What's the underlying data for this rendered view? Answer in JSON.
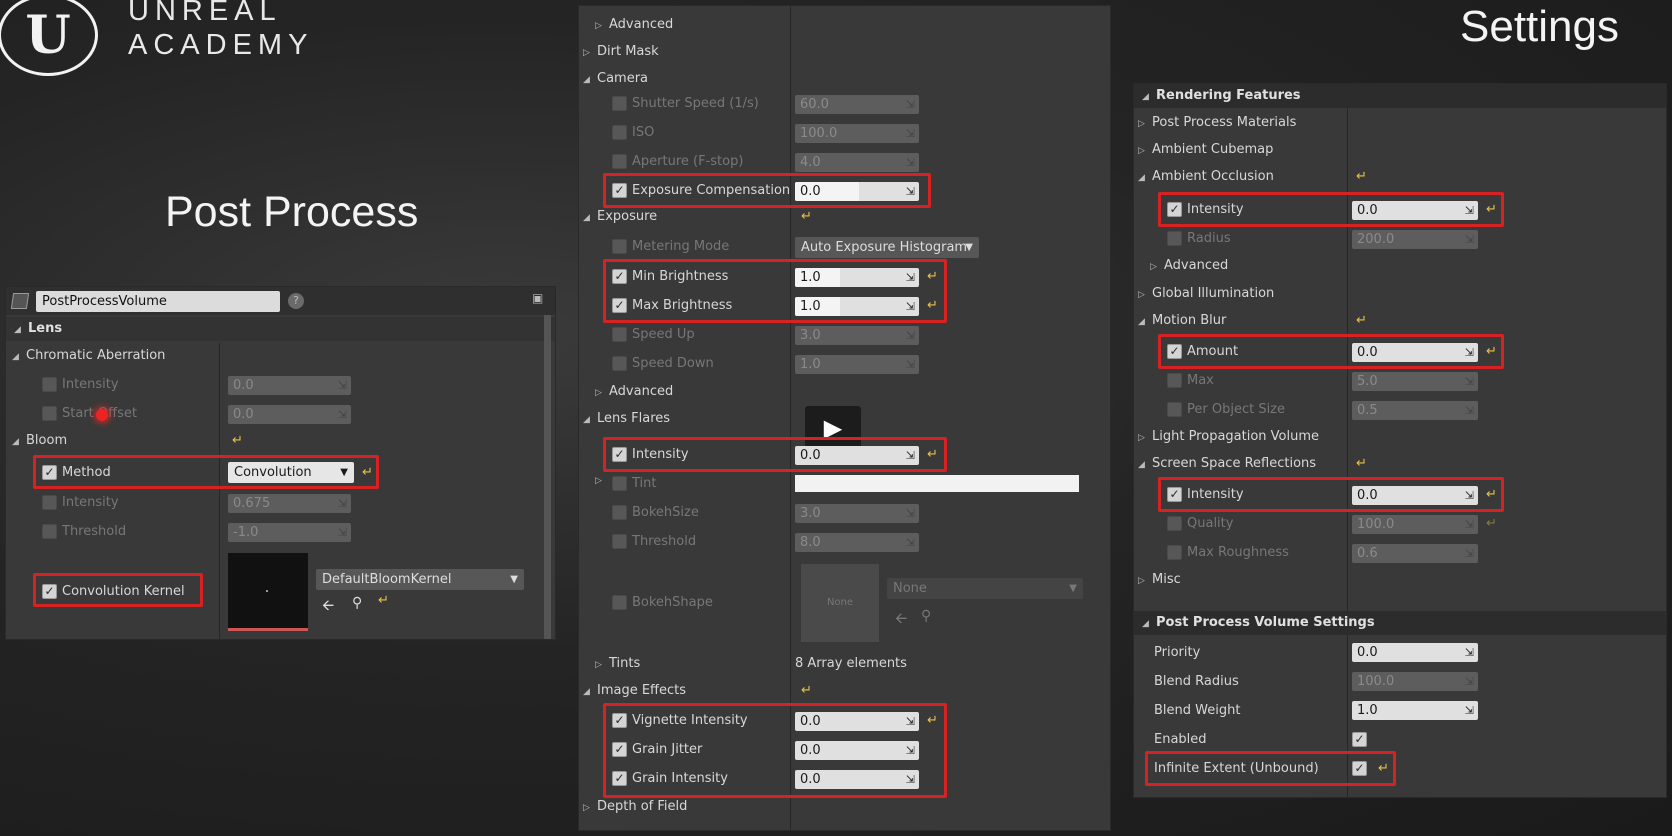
{
  "brand": {
    "line1": "UNREAL",
    "line2": "ACADEMY",
    "logo_letter": "U"
  },
  "slide": {
    "title_left": "Post Process",
    "title_right": "Settings"
  },
  "left": {
    "actor_name": "PostProcessVolume",
    "help_icon": "?",
    "header": "Lens",
    "chromatic": {
      "label": "Chromatic Aberration",
      "intensity_label": "Intensity",
      "intensity_value": "0.0",
      "start_offset_label": "Start Offset",
      "start_offset_value": "0.0"
    },
    "bloom": {
      "label": "Bloom",
      "method_label": "Method",
      "method_value": "Convolution",
      "intensity_label": "Intensity",
      "intensity_value": "0.675",
      "threshold_label": "Threshold",
      "threshold_value": "-1.0",
      "kernel_label": "Convolution Kernel",
      "kernel_asset": "DefaultBloomKernel"
    }
  },
  "middle": {
    "advanced_top": "Advanced",
    "dirt_mask": "Dirt Mask",
    "camera": {
      "label": "Camera",
      "shutter_label": "Shutter Speed (1/s)",
      "shutter_value": "60.0",
      "iso_label": "ISO",
      "iso_value": "100.0",
      "aperture_label": "Aperture (F-stop)",
      "aperture_value": "4.0",
      "exposure_comp_label": "Exposure Compensation",
      "exposure_comp_value": "0.0"
    },
    "exposure": {
      "label": "Exposure",
      "metering_label": "Metering Mode",
      "metering_value": "Auto Exposure Histogram",
      "min_label": "Min Brightness",
      "min_value": "1.0",
      "max_label": "Max Brightness",
      "max_value": "1.0",
      "speed_up_label": "Speed Up",
      "speed_up_value": "3.0",
      "speed_down_label": "Speed Down",
      "speed_down_value": "1.0",
      "advanced": "Advanced"
    },
    "lens_flares": {
      "label": "Lens Flares",
      "intensity_label": "Intensity",
      "intensity_value": "0.0",
      "tint_label": "Tint",
      "bokeh_size_label": "BokehSize",
      "bokeh_size_value": "3.0",
      "threshold_label": "Threshold",
      "threshold_value": "8.0",
      "bokeh_shape_label": "BokehShape",
      "bokeh_shape_thumb": "None",
      "bokeh_shape_value": "None"
    },
    "tints": {
      "label": "Tints",
      "value": "8 Array elements"
    },
    "image_effects": {
      "label": "Image Effects",
      "vignette_label": "Vignette Intensity",
      "vignette_value": "0.0",
      "grain_jitter_label": "Grain Jitter",
      "grain_jitter_value": "0.0",
      "grain_intensity_label": "Grain Intensity",
      "grain_intensity_value": "0.0"
    },
    "depth_of_field": "Depth of Field"
  },
  "right": {
    "header": "Rendering Features",
    "ppm": "Post Process Materials",
    "ambient_cubemap": "Ambient Cubemap",
    "ambient_occlusion": {
      "label": "Ambient Occlusion",
      "intensity_label": "Intensity",
      "intensity_value": "0.0",
      "radius_label": "Radius",
      "radius_value": "200.0",
      "advanced": "Advanced"
    },
    "global_illumination": "Global Illumination",
    "motion_blur": {
      "label": "Motion Blur",
      "amount_label": "Amount",
      "amount_value": "0.0",
      "max_label": "Max",
      "max_value": "5.0",
      "per_object_label": "Per Object Size",
      "per_object_value": "0.5"
    },
    "lpv": "Light Propagation Volume",
    "ssr": {
      "label": "Screen Space Reflections",
      "intensity_label": "Intensity",
      "intensity_value": "0.0",
      "quality_label": "Quality",
      "quality_value": "100.0",
      "max_roughness_label": "Max Roughness",
      "max_roughness_value": "0.6"
    },
    "misc": "Misc",
    "ppv_header": "Post Process Volume Settings",
    "ppv": {
      "priority_label": "Priority",
      "priority_value": "0.0",
      "blend_radius_label": "Blend Radius",
      "blend_radius_value": "100.0",
      "blend_weight_label": "Blend Weight",
      "blend_weight_value": "1.0",
      "enabled_label": "Enabled",
      "infinite_label": "Infinite Extent (Unbound)"
    }
  },
  "colors": {
    "highlight": "#d62222",
    "panel_bg": "#393939",
    "reset_arrow": "#e8c24a"
  },
  "icons": {
    "expand": "triangle-right-icon",
    "collapse": "triangle-down-icon",
    "reset": "reset-arrow-icon",
    "play": "play-icon",
    "lock": "lock-icon",
    "browse": "browse-arrow-icon",
    "search": "search-icon",
    "check": "checkmark-icon"
  }
}
